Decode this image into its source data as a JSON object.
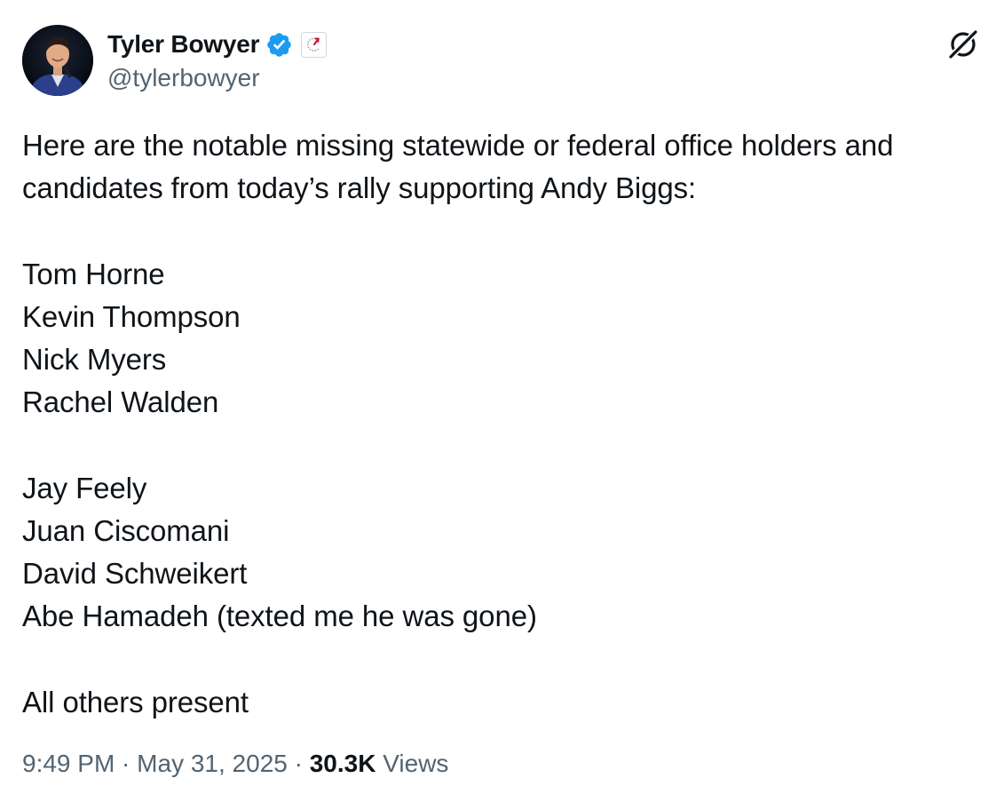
{
  "author": {
    "display_name": "Tyler Bowyer",
    "handle": "@tylerbowyer",
    "verified_icon": "verified-badge-icon",
    "affiliation_icon": "affiliation-badge-icon",
    "verified_color": "#1d9bf0"
  },
  "tweet": {
    "intro_line_1": "Here are the notable missing statewide or federal office holders and",
    "intro_line_2": "candidates from today’s rally supporting Andy Biggs:",
    "group_one": [
      "Tom Horne",
      "Kevin Thompson",
      "Nick Myers",
      "Rachel Walden"
    ],
    "group_two": [
      "Jay Feely",
      "Juan Ciscomani",
      "David Schweikert",
      "Abe Hamadeh (texted me he was gone)"
    ],
    "closing": "All others present"
  },
  "meta": {
    "time": "9:49 PM",
    "separator": " · ",
    "date": "May 31, 2025",
    "views_count": "30.3K",
    "views_label": "Views"
  },
  "colors": {
    "text_primary": "#0f1419",
    "text_secondary": "#536471",
    "accent": "#1d9bf0"
  }
}
